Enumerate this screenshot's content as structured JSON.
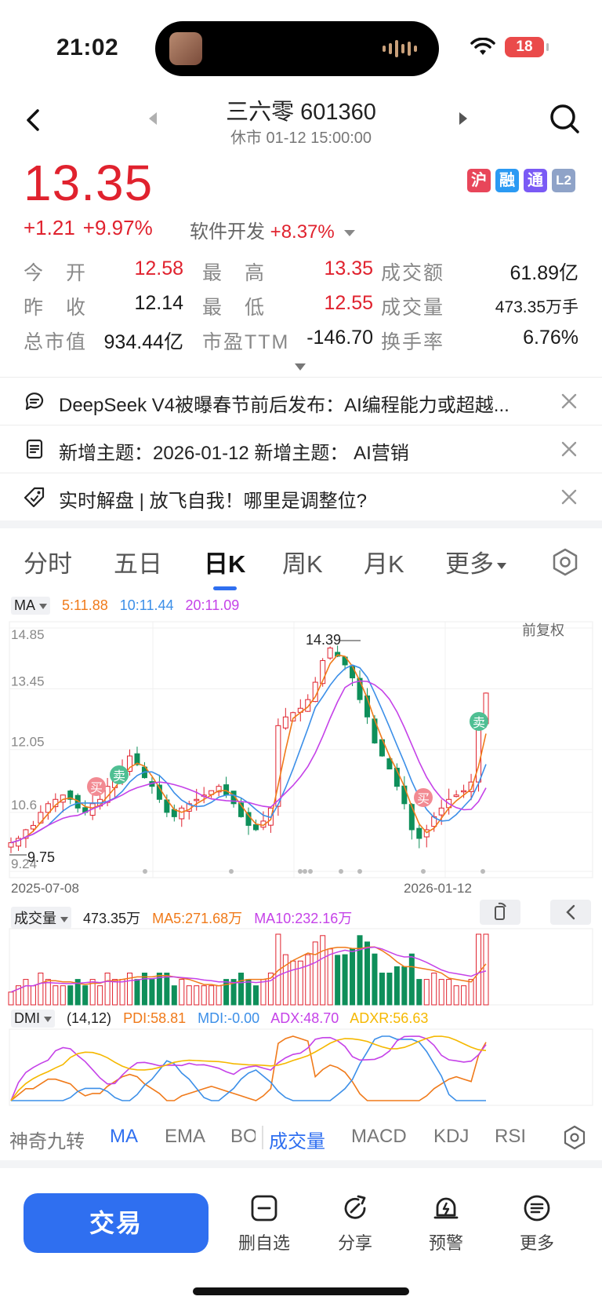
{
  "status_bar": {
    "time": "21:02",
    "battery": "18"
  },
  "header": {
    "title": "三六零 601360",
    "subtitle": "休市 01-12 15:00:00"
  },
  "quote": {
    "price": "13.35",
    "change": "+1.21",
    "change_pct": "+9.97%",
    "sector_name": "软件开发",
    "sector_pct": "+8.37%",
    "badges": [
      "沪",
      "融",
      "通",
      "L2"
    ]
  },
  "stats": [
    [
      {
        "label": "今　开",
        "value": "12.58",
        "red": true
      },
      {
        "label": "最　高",
        "value": "13.35",
        "red": true
      },
      {
        "label": "成交额",
        "value": "61.89亿",
        "red": false
      }
    ],
    [
      {
        "label": "昨　收",
        "value": "12.14",
        "red": false
      },
      {
        "label": "最　低",
        "value": "12.55",
        "red": true
      },
      {
        "label": "成交量",
        "value": "473.35万手",
        "red": false
      }
    ],
    [
      {
        "label": "总市值",
        "value": "934.44亿",
        "red": false
      },
      {
        "label": "市盈TTM",
        "value": "-146.70",
        "red": false
      },
      {
        "label": "换手率",
        "value": "6.76%",
        "red": false
      }
    ]
  ],
  "news": [
    {
      "icon": "chat-icon",
      "text": "DeepSeek V4被曝春节前后发布：AI编程能力或超越..."
    },
    {
      "icon": "document-icon",
      "text": "新增主题：2026-01-12 新增主题： AI营销"
    },
    {
      "icon": "tag-icon",
      "text": "实时解盘 | 放飞自我！哪里是调整位?"
    }
  ],
  "chart_tabs": [
    "分时",
    "五日",
    "日K",
    "周K",
    "月K",
    "更多"
  ],
  "active_tab": "日K",
  "ma_line": {
    "label": "MA",
    "ma5": "5:11.88",
    "ma10": "10:11.44",
    "ma20": "20:11.09"
  },
  "price_axis": [
    "14.85",
    "13.45",
    "12.05",
    "10.6",
    "9.24"
  ],
  "adjust_label": "前复权",
  "peak_label": "14.39",
  "low_label": "9.75",
  "date_start": "2025-07-08",
  "date_end": "2026-01-12",
  "markers": {
    "buy": "买",
    "sell": "卖"
  },
  "volume_line": {
    "label": "成交量",
    "value": "473.35万",
    "ma5": "MA5:271.68万",
    "ma10": "MA10:232.16万"
  },
  "dmi_line": {
    "label": "DMI",
    "params": "(14,12)",
    "pdi": "PDI:58.81",
    "mdi": "MDI:-0.00",
    "adx": "ADX:48.70",
    "adxr": "ADXR:56.63"
  },
  "indicator_tabs": [
    "神奇九转",
    "MA",
    "EMA",
    "BO",
    "成交量",
    "MACD",
    "KDJ",
    "RSI"
  ],
  "bottom_bar": {
    "trade": "交易",
    "items": [
      "删自选",
      "分享",
      "预警",
      "更多"
    ]
  },
  "colors": {
    "up": "#e0222e",
    "down": "#0e8f5a",
    "accent": "#2f6ff0",
    "ma5": "#f07a1a",
    "ma10": "#3c8fe8",
    "ma20": "#c542e8",
    "adxr": "#f5b800"
  },
  "chart_data": {
    "type": "candlestick",
    "x_range": [
      "2025-07-08",
      "2026-01-12"
    ],
    "ylim": [
      9.24,
      14.85
    ],
    "y_ticks": [
      14.85,
      13.45,
      12.05,
      10.6,
      9.24
    ],
    "last_close": 13.35,
    "period_high": 14.39,
    "period_low": 9.75,
    "ma": {
      "ma5": 11.88,
      "ma10": 11.44,
      "ma20": 11.09
    },
    "series": [
      {
        "values": [
          9.9,
          10.0,
          10.2,
          10.3,
          10.6,
          10.8,
          10.9,
          11.0,
          10.9,
          10.7,
          10.6,
          10.8,
          10.9,
          11.2,
          11.4,
          11.6,
          11.9,
          11.7,
          11.4,
          11.2,
          10.9,
          10.6,
          10.5,
          10.7,
          10.8,
          10.9,
          11.0,
          11.1,
          11.2,
          11.0,
          10.8,
          10.5,
          10.3,
          10.2,
          10.4,
          10.7,
          12.6,
          12.8,
          12.9,
          13.0,
          13.2,
          13.6,
          14.1,
          14.39,
          14.2,
          14.0,
          13.7,
          13.2,
          12.8,
          12.2,
          11.9,
          11.6,
          11.2,
          10.8,
          10.2,
          10.0,
          10.2,
          10.5,
          10.7,
          10.9,
          11.0,
          11.1,
          11.3,
          12.6,
          13.35
        ]
      }
    ]
  }
}
